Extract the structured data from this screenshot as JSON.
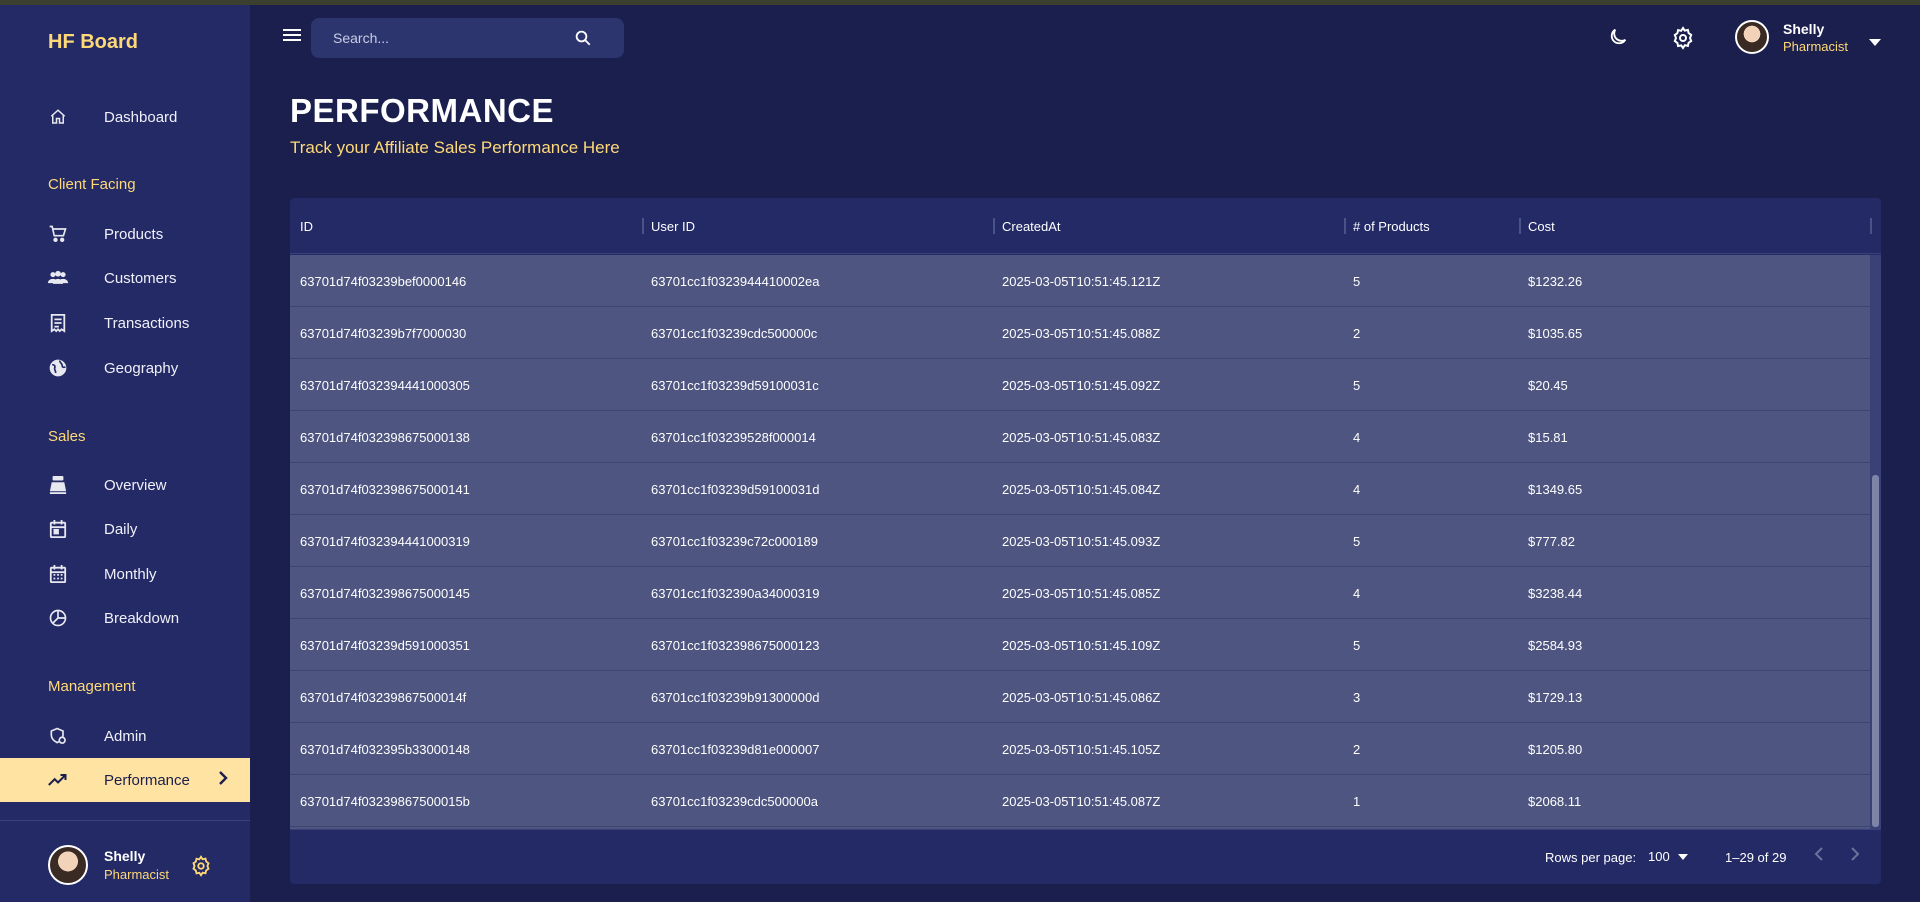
{
  "app": {
    "brand": "HF Board"
  },
  "colors": {
    "sidebar_bg": "#232a66",
    "accent": "#ffd978",
    "active_bg": "#ffe3a3",
    "row_bg": "#4d5580"
  },
  "sidebar": {
    "dashboard": {
      "label": "Dashboard",
      "icon": "home-icon"
    },
    "sections": {
      "client": "Client Facing",
      "sales": "Sales",
      "management": "Management"
    },
    "client_items": [
      {
        "label": "Products",
        "icon": "cart-icon"
      },
      {
        "label": "Customers",
        "icon": "group-icon"
      },
      {
        "label": "Transactions",
        "icon": "receipt-icon"
      },
      {
        "label": "Geography",
        "icon": "globe-icon"
      }
    ],
    "sales_items": [
      {
        "label": "Overview",
        "icon": "point-of-sale-icon"
      },
      {
        "label": "Daily",
        "icon": "calendar-day-icon"
      },
      {
        "label": "Monthly",
        "icon": "calendar-month-icon"
      },
      {
        "label": "Breakdown",
        "icon": "pie-chart-icon"
      }
    ],
    "management_items": [
      {
        "label": "Admin",
        "icon": "admin-icon"
      },
      {
        "label": "Performance",
        "icon": "trending-up-icon",
        "active": true
      }
    ],
    "user": {
      "name": "Shelly",
      "role": "Pharmacist"
    }
  },
  "topbar": {
    "search_placeholder": "Search...",
    "user": {
      "name": "Shelly",
      "role": "Pharmacist"
    }
  },
  "header": {
    "title": "PERFORMANCE",
    "subtitle": "Track your Affiliate Sales Performance Here"
  },
  "table": {
    "columns": [
      "ID",
      "User ID",
      "CreatedAt",
      "# of Products",
      "Cost"
    ],
    "rows": [
      [
        "63701d74f03239bef0000146",
        "63701cc1f0323944410002ea",
        "2025-03-05T10:51:45.121Z",
        "5",
        "$1232.26"
      ],
      [
        "63701d74f03239b7f7000030",
        "63701cc1f03239cdc500000c",
        "2025-03-05T10:51:45.088Z",
        "2",
        "$1035.65"
      ],
      [
        "63701d74f032394441000305",
        "63701cc1f03239d59100031c",
        "2025-03-05T10:51:45.092Z",
        "5",
        "$20.45"
      ],
      [
        "63701d74f032398675000138",
        "63701cc1f03239528f000014",
        "2025-03-05T10:51:45.083Z",
        "4",
        "$15.81"
      ],
      [
        "63701d74f032398675000141",
        "63701cc1f03239d59100031d",
        "2025-03-05T10:51:45.084Z",
        "4",
        "$1349.65"
      ],
      [
        "63701d74f032394441000319",
        "63701cc1f03239c72c000189",
        "2025-03-05T10:51:45.093Z",
        "5",
        "$777.82"
      ],
      [
        "63701d74f032398675000145",
        "63701cc1f032390a34000319",
        "2025-03-05T10:51:45.085Z",
        "4",
        "$3238.44"
      ],
      [
        "63701d74f03239d591000351",
        "63701cc1f032398675000123",
        "2025-03-05T10:51:45.109Z",
        "5",
        "$2584.93"
      ],
      [
        "63701d74f03239867500014f",
        "63701cc1f03239b91300000d",
        "2025-03-05T10:51:45.086Z",
        "3",
        "$1729.13"
      ],
      [
        "63701d74f032395b33000148",
        "63701cc1f03239d81e000007",
        "2025-03-05T10:51:45.105Z",
        "2",
        "$1205.80"
      ],
      [
        "63701d74f03239867500015b",
        "63701cc1f03239cdc500000a",
        "2025-03-05T10:51:45.087Z",
        "1",
        "$2068.11"
      ]
    ],
    "footer": {
      "rows_per_page_label": "Rows per page:",
      "rows_per_page_value": "100",
      "range": "1–29 of 29"
    }
  }
}
